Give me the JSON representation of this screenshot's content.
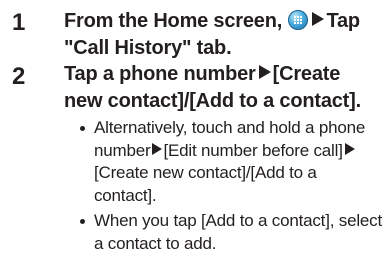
{
  "steps": [
    {
      "number": "1",
      "line1_part1": "From the Home screen, ",
      "icon": "app-drawer-icon",
      "line1_part2": "Tap",
      "line2": "\"Call History\" tab."
    },
    {
      "number": "2",
      "part1": "Tap a phone number",
      "part2": "[Create new contact]/[Add to a contact].",
      "bullets": [
        {
          "part1": "Alternatively, touch and hold a phone number",
          "part2": "[Edit number before call]",
          "part3": "[Create new contact]/[Add to a contact]."
        },
        {
          "text": "When you tap [Add to a contact], select a contact to add."
        }
      ]
    }
  ]
}
